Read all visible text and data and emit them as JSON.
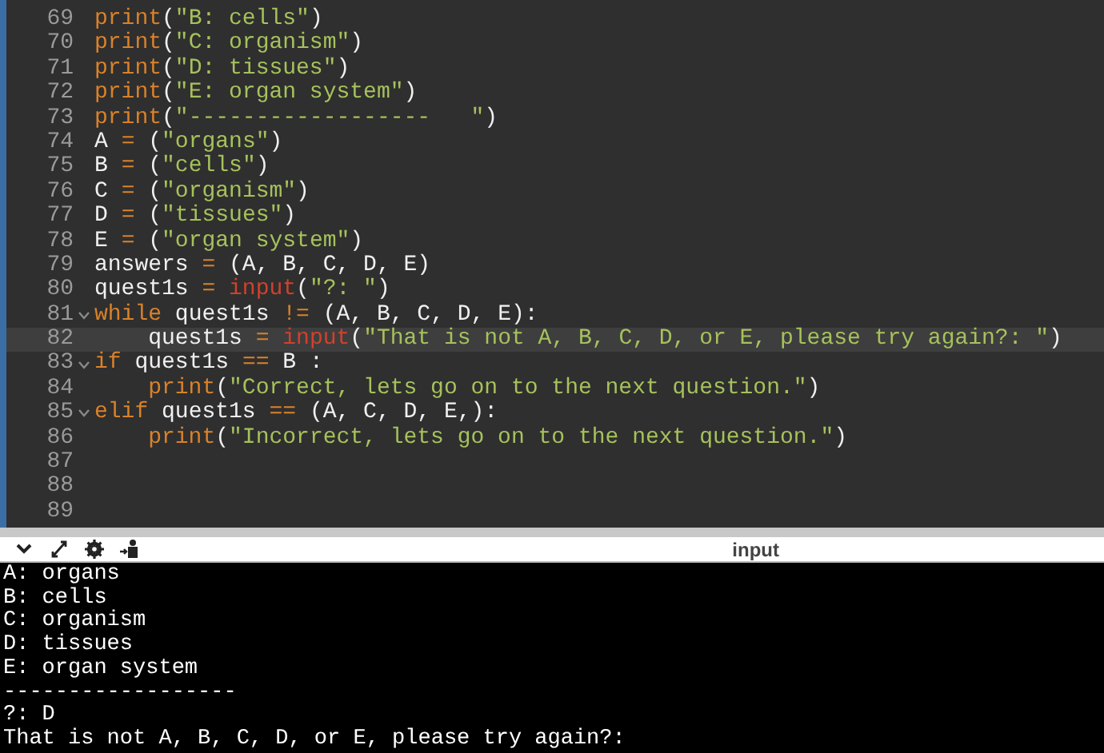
{
  "editor": {
    "lines": [
      {
        "number": "69",
        "foldable": false,
        "active": false,
        "tokens": [
          {
            "kind": "fn",
            "text": "print"
          },
          {
            "kind": "plain",
            "text": "("
          },
          {
            "kind": "str",
            "text": "\"B: cells\""
          },
          {
            "kind": "plain",
            "text": ")"
          }
        ]
      },
      {
        "number": "70",
        "foldable": false,
        "active": false,
        "tokens": [
          {
            "kind": "fn",
            "text": "print"
          },
          {
            "kind": "plain",
            "text": "("
          },
          {
            "kind": "str",
            "text": "\"C: organism\""
          },
          {
            "kind": "plain",
            "text": ")"
          }
        ]
      },
      {
        "number": "71",
        "foldable": false,
        "active": false,
        "tokens": [
          {
            "kind": "fn",
            "text": "print"
          },
          {
            "kind": "plain",
            "text": "("
          },
          {
            "kind": "str",
            "text": "\"D: tissues\""
          },
          {
            "kind": "plain",
            "text": ")"
          }
        ]
      },
      {
        "number": "72",
        "foldable": false,
        "active": false,
        "tokens": [
          {
            "kind": "fn",
            "text": "print"
          },
          {
            "kind": "plain",
            "text": "("
          },
          {
            "kind": "str",
            "text": "\"E: organ system\""
          },
          {
            "kind": "plain",
            "text": ")"
          }
        ]
      },
      {
        "number": "73",
        "foldable": false,
        "active": false,
        "tokens": [
          {
            "kind": "fn",
            "text": "print"
          },
          {
            "kind": "plain",
            "text": "("
          },
          {
            "kind": "str",
            "text": "\"------------------   \""
          },
          {
            "kind": "plain",
            "text": ")"
          }
        ]
      },
      {
        "number": "74",
        "foldable": false,
        "active": false,
        "tokens": [
          {
            "kind": "plain",
            "text": "A "
          },
          {
            "kind": "op",
            "text": "="
          },
          {
            "kind": "plain",
            "text": " ("
          },
          {
            "kind": "str",
            "text": "\"organs\""
          },
          {
            "kind": "plain",
            "text": ")"
          }
        ]
      },
      {
        "number": "75",
        "foldable": false,
        "active": false,
        "tokens": [
          {
            "kind": "plain",
            "text": "B "
          },
          {
            "kind": "op",
            "text": "="
          },
          {
            "kind": "plain",
            "text": " ("
          },
          {
            "kind": "str",
            "text": "\"cells\""
          },
          {
            "kind": "plain",
            "text": ")"
          }
        ]
      },
      {
        "number": "76",
        "foldable": false,
        "active": false,
        "tokens": [
          {
            "kind": "plain",
            "text": "C "
          },
          {
            "kind": "op",
            "text": "="
          },
          {
            "kind": "plain",
            "text": " ("
          },
          {
            "kind": "str",
            "text": "\"organism\""
          },
          {
            "kind": "plain",
            "text": ")"
          }
        ]
      },
      {
        "number": "77",
        "foldable": false,
        "active": false,
        "tokens": [
          {
            "kind": "plain",
            "text": "D "
          },
          {
            "kind": "op",
            "text": "="
          },
          {
            "kind": "plain",
            "text": " ("
          },
          {
            "kind": "str",
            "text": "\"tissues\""
          },
          {
            "kind": "plain",
            "text": ")"
          }
        ]
      },
      {
        "number": "78",
        "foldable": false,
        "active": false,
        "tokens": [
          {
            "kind": "plain",
            "text": "E "
          },
          {
            "kind": "op",
            "text": "="
          },
          {
            "kind": "plain",
            "text": " ("
          },
          {
            "kind": "str",
            "text": "\"organ system\""
          },
          {
            "kind": "plain",
            "text": ")"
          }
        ]
      },
      {
        "number": "79",
        "foldable": false,
        "active": false,
        "tokens": [
          {
            "kind": "plain",
            "text": "answers "
          },
          {
            "kind": "op",
            "text": "="
          },
          {
            "kind": "plain",
            "text": " (A, B, C, D, E)"
          }
        ]
      },
      {
        "number": "80",
        "foldable": false,
        "active": false,
        "tokens": [
          {
            "kind": "plain",
            "text": "quest1s "
          },
          {
            "kind": "op",
            "text": "= "
          },
          {
            "kind": "builtin",
            "text": "input"
          },
          {
            "kind": "plain",
            "text": "("
          },
          {
            "kind": "str",
            "text": "\"?: \""
          },
          {
            "kind": "plain",
            "text": ")"
          }
        ]
      },
      {
        "number": "81",
        "foldable": true,
        "active": false,
        "tokens": [
          {
            "kind": "kw",
            "text": "while"
          },
          {
            "kind": "plain",
            "text": " quest1s "
          },
          {
            "kind": "op",
            "text": "!="
          },
          {
            "kind": "plain",
            "text": " (A, B, C, D, E):"
          }
        ]
      },
      {
        "number": "82",
        "foldable": false,
        "active": true,
        "tokens": [
          {
            "kind": "plain",
            "text": "    quest1s "
          },
          {
            "kind": "op",
            "text": "= "
          },
          {
            "kind": "builtin",
            "text": "input"
          },
          {
            "kind": "plain",
            "text": "("
          },
          {
            "kind": "str",
            "text": "\"That is not A, B, C, D, or E, please try again?: \""
          },
          {
            "kind": "plain",
            "text": ")"
          }
        ]
      },
      {
        "number": "83",
        "foldable": true,
        "active": false,
        "tokens": [
          {
            "kind": "kw",
            "text": "if"
          },
          {
            "kind": "plain",
            "text": " quest1s "
          },
          {
            "kind": "op",
            "text": "=="
          },
          {
            "kind": "plain",
            "text": " B :"
          }
        ]
      },
      {
        "number": "84",
        "foldable": false,
        "active": false,
        "tokens": [
          {
            "kind": "fn",
            "text": "    print"
          },
          {
            "kind": "plain",
            "text": "("
          },
          {
            "kind": "str",
            "text": "\"Correct, lets go on to the next question.\""
          },
          {
            "kind": "plain",
            "text": ")"
          }
        ]
      },
      {
        "number": "85",
        "foldable": true,
        "active": false,
        "tokens": [
          {
            "kind": "kw",
            "text": "elif"
          },
          {
            "kind": "plain",
            "text": " quest1s "
          },
          {
            "kind": "op",
            "text": "=="
          },
          {
            "kind": "plain",
            "text": " (A, C, D, E,):"
          }
        ]
      },
      {
        "number": "86",
        "foldable": false,
        "active": false,
        "tokens": [
          {
            "kind": "fn",
            "text": "    print"
          },
          {
            "kind": "plain",
            "text": "("
          },
          {
            "kind": "str",
            "text": "\"Incorrect, lets go on to the next question.\""
          },
          {
            "kind": "plain",
            "text": ")"
          }
        ]
      },
      {
        "number": "87",
        "foldable": false,
        "active": false
      },
      {
        "number": "88",
        "foldable": false,
        "active": false
      },
      {
        "number": "89",
        "foldable": false,
        "active": false
      }
    ]
  },
  "console": {
    "title": "input",
    "lines": [
      "A: organs",
      "B: cells",
      "C: organism",
      "D: tissues",
      "E: organ system",
      "------------------",
      "?: D",
      "That is not A, B, C, D, or E, please try again?:"
    ]
  }
}
